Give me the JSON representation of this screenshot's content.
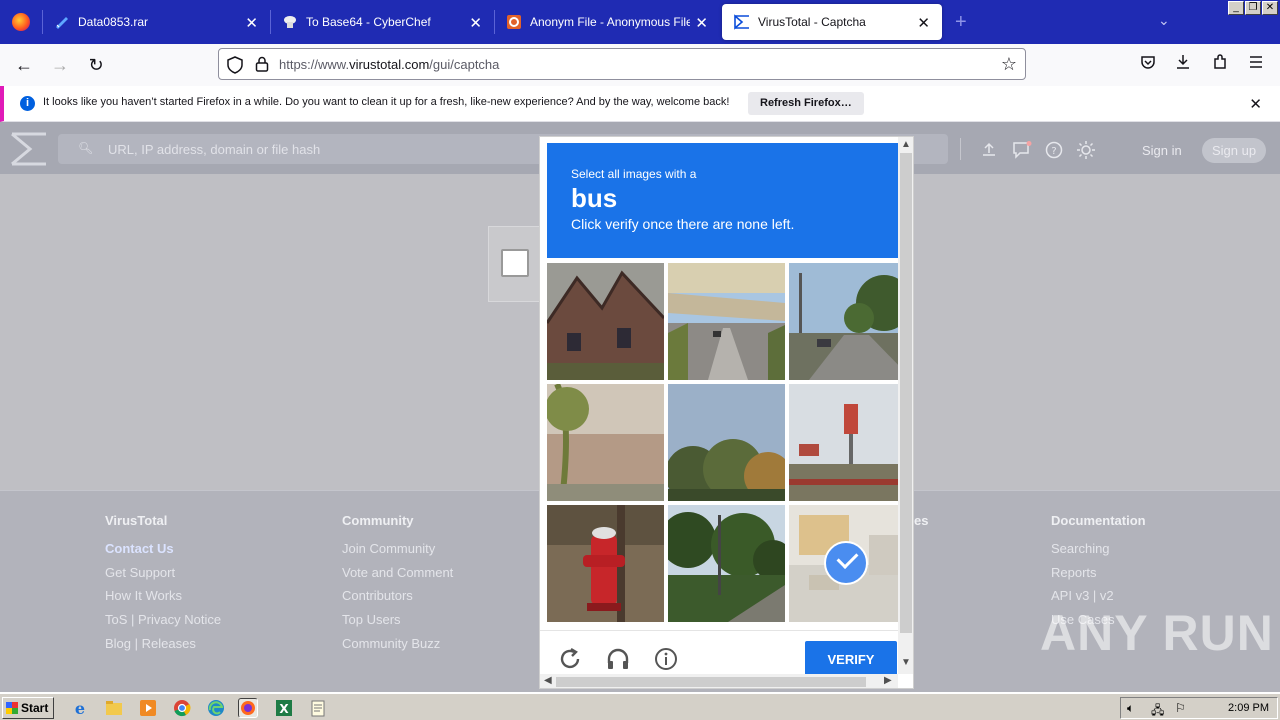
{
  "browser": {
    "tabs": [
      {
        "title": "Data0853.rar",
        "icon": "rar-download-icon"
      },
      {
        "title": "To Base64 - CyberChef",
        "icon": "cyberchef-icon"
      },
      {
        "title": "Anonym File - Anonymous File Uplo",
        "icon": "anonymfile-icon"
      },
      {
        "title": "VirusTotal - Captcha",
        "icon": "virustotal-icon",
        "active": true
      }
    ],
    "url_prefix": "https://www.",
    "url_domain": "virustotal.com",
    "url_path": "/gui/captcha"
  },
  "notification": {
    "message": "It looks like you haven’t started Firefox in a while. Do you want to clean it up for a fresh, like-new experience? And by the way, welcome back!",
    "button": "Refresh Firefox…"
  },
  "virustotal": {
    "search_placeholder": "URL, IP address, domain or file hash",
    "sign_in": "Sign in",
    "sign_up": "Sign up"
  },
  "captcha": {
    "instruction_line1": "Select all images with a",
    "target": "bus",
    "instruction_line3": "Click verify once there are none left.",
    "verify_label": "VERIFY",
    "tiles": [
      {
        "scene": "brick-house",
        "selected": false
      },
      {
        "scene": "highway-overpass",
        "selected": false
      },
      {
        "scene": "street-with-trees",
        "selected": false
      },
      {
        "scene": "wall-and-palm",
        "selected": false
      },
      {
        "scene": "treetops-sky",
        "selected": false
      },
      {
        "scene": "parking-lot-signs",
        "selected": false
      },
      {
        "scene": "fire-hydrant",
        "selected": false
      },
      {
        "scene": "trees-road",
        "selected": false
      },
      {
        "scene": "street-traffic",
        "selected": true
      }
    ]
  },
  "footer": {
    "columns": [
      {
        "heading": "VirusTotal",
        "links": [
          "Contact Us",
          "Get Support",
          "How It Works",
          "ToS | Privacy Notice",
          "Blog | Releases"
        ]
      },
      {
        "heading": "Community",
        "links": [
          "Join Community",
          "Vote and Comment",
          "Contributors",
          "Top Users",
          "Community Buzz"
        ]
      },
      {
        "heading": "es",
        "links": []
      },
      {
        "heading": "Documentation",
        "links": [
          "Searching",
          "Reports",
          "API v3 | v2",
          "Use Cases"
        ]
      }
    ]
  },
  "watermark": "ANY RUN",
  "taskbar": {
    "start_label": "Start",
    "clock": "2:09 PM"
  },
  "colors": {
    "tabstrip": "#1f2bb3",
    "captcha_blue": "#1a73e8"
  }
}
